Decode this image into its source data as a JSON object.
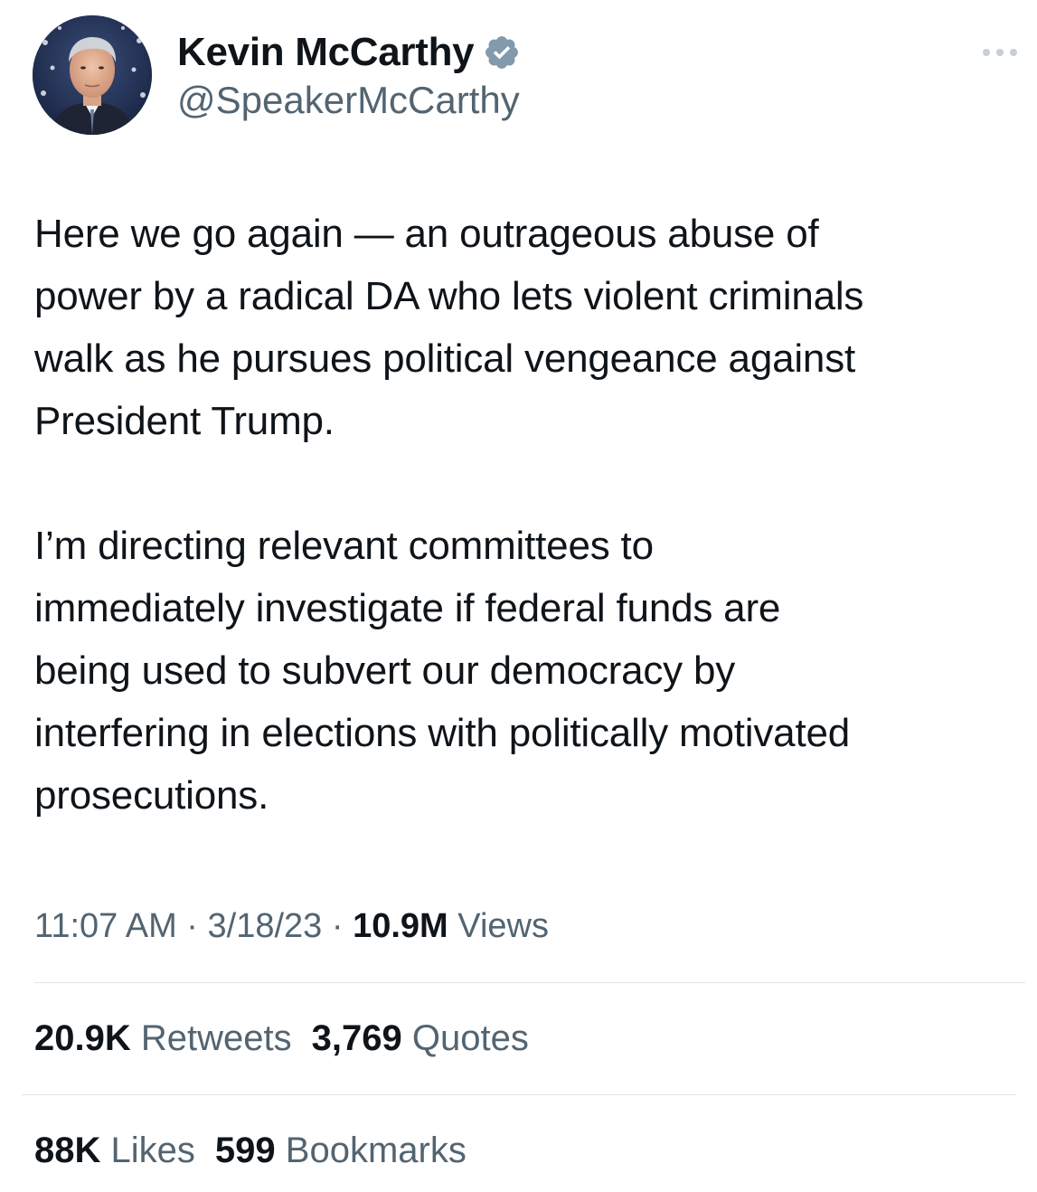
{
  "author": {
    "name": "Kevin McCarthy",
    "handle": "@SpeakerMcCarthy"
  },
  "tweet": {
    "paragraphs": [
      [
        "Here we go again — an outrageous abuse of",
        "power by a radical DA who lets violent criminals",
        "walk as he pursues political vengeance against",
        "President Trump."
      ],
      [
        "I’m directing relevant committees to",
        "immediately investigate if federal funds are",
        "being used to subvert our democracy by",
        "interfering in elections with politically motivated",
        "prosecutions."
      ]
    ]
  },
  "meta": {
    "time": "11:07 AM",
    "separator": " · ",
    "date": "3/18/23",
    "views_count": "10.9M",
    "views_label": "Views"
  },
  "stats": {
    "retweets_count": "20.9K",
    "retweets_label": "Retweets",
    "quotes_count": "3,769",
    "quotes_label": "Quotes",
    "likes_count": "88K",
    "likes_label": "Likes",
    "bookmarks_count": "599",
    "bookmarks_label": "Bookmarks"
  },
  "icons": {
    "verified": "verified-badge-icon",
    "more": "more-options-icon"
  },
  "colors": {
    "text_primary": "#0f1419",
    "text_secondary": "#536471",
    "verified_badge": "#829aab",
    "divider": "#dfe3e6"
  }
}
